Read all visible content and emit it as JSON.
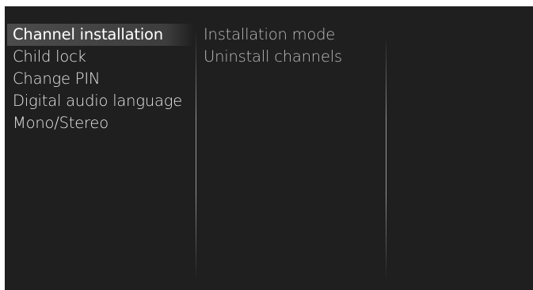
{
  "main_menu": {
    "items": [
      {
        "label": "Channel installation",
        "selected": true
      },
      {
        "label": "Child lock",
        "selected": false
      },
      {
        "label": "Change PIN",
        "selected": false
      },
      {
        "label": "Digital audio language",
        "selected": false
      },
      {
        "label": "Mono/Stereo",
        "selected": false
      }
    ]
  },
  "sub_menu": {
    "items": [
      {
        "label": "Installation mode"
      },
      {
        "label": "Uninstall channels"
      }
    ]
  }
}
